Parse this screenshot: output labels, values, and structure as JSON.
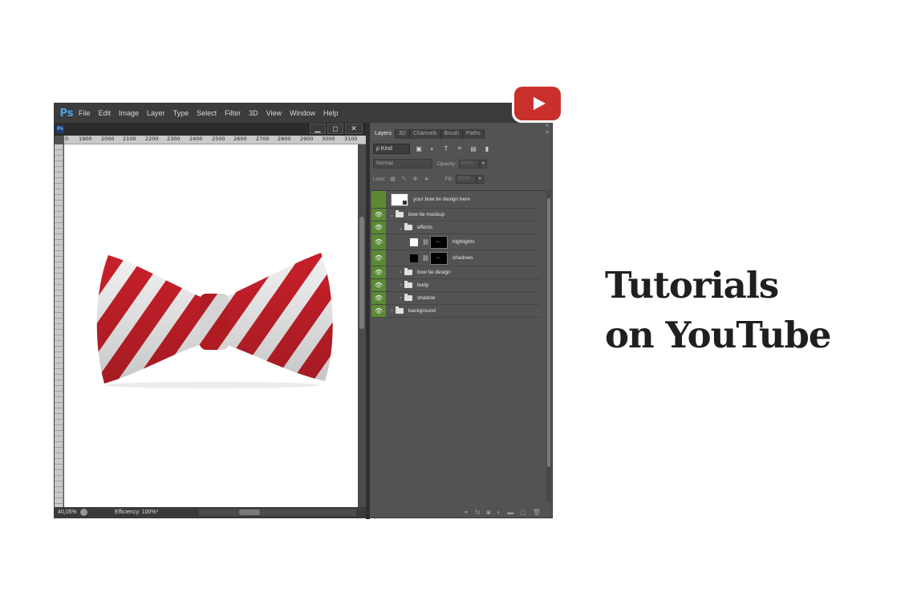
{
  "app": {
    "logo": "Ps",
    "mini_logo": "Ps"
  },
  "menu": [
    "File",
    "Edit",
    "Image",
    "Layer",
    "Type",
    "Select",
    "Filter",
    "3D",
    "View",
    "Window",
    "Help"
  ],
  "window_buttons": {
    "minimize": "▁",
    "maximize": "◻",
    "close": "✕"
  },
  "ruler_top": [
    "0",
    "1900",
    "2000",
    "2100",
    "2200",
    "2300",
    "2400",
    "2500",
    "2600",
    "2700",
    "2800",
    "2900",
    "3000",
    "3100"
  ],
  "status": {
    "zoom": "40,05%",
    "efficiency": "Efficiency: 100%*"
  },
  "panel": {
    "collapse": "»",
    "menu": "≡",
    "tabs": [
      "Layers",
      "3D",
      "Channels",
      "Brush",
      "Paths"
    ],
    "active_tab": "Layers",
    "filter_kind": "ρ Kind",
    "blend_mode": "Normal",
    "opacity_label": "Opacity:",
    "opacity_value": "100%",
    "lock_label": "Lock:",
    "fill_label": "Fill:",
    "fill_value": "100%"
  },
  "layers": [
    {
      "name": "your bow tie design here",
      "visible": false,
      "type": "smart"
    },
    {
      "name": "bow tie mockup",
      "visible": true,
      "type": "group",
      "expanded": true
    },
    {
      "name": "effects",
      "visible": true,
      "type": "group",
      "expanded": true
    },
    {
      "name": "highlights",
      "visible": true,
      "type": "adjust",
      "fill": "white"
    },
    {
      "name": "shadows",
      "visible": true,
      "type": "adjust",
      "fill": "black"
    },
    {
      "name": "bow tie design",
      "visible": true,
      "type": "group"
    },
    {
      "name": "body",
      "visible": true,
      "type": "group"
    },
    {
      "name": "shadow",
      "visible": true,
      "type": "group"
    },
    {
      "name": "background",
      "visible": true,
      "type": "group"
    }
  ],
  "headline": {
    "line1": "Tutorials",
    "line2": "on YouTube"
  },
  "colors": {
    "youtube_red": "#c9302c",
    "eye_green": "#5b8a33",
    "bowtie_red": "#c8202a"
  }
}
